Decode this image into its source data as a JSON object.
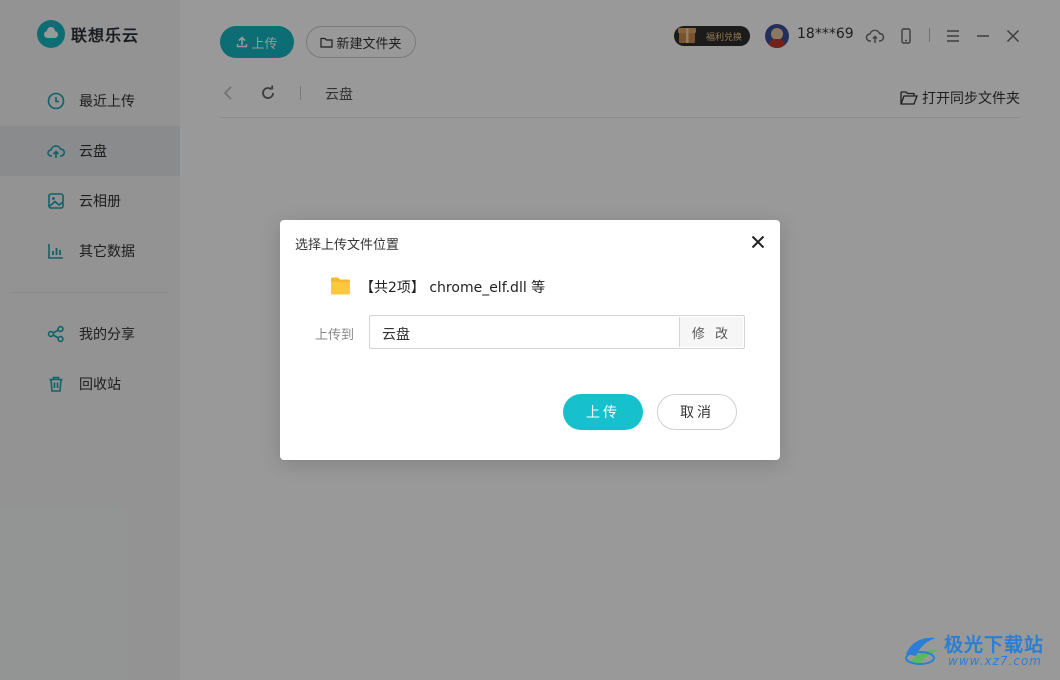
{
  "app": {
    "name": "联想乐云"
  },
  "sidebar": {
    "items": [
      {
        "label": "最近上传",
        "icon": "clock-icon"
      },
      {
        "label": "云盘",
        "icon": "cloud-upload-icon",
        "active": true
      },
      {
        "label": "云相册",
        "icon": "image-icon"
      },
      {
        "label": "其它数据",
        "icon": "bar-chart-icon"
      },
      {
        "label": "我的分享",
        "icon": "share-icon"
      },
      {
        "label": "回收站",
        "icon": "trash-icon"
      }
    ]
  },
  "toolbar": {
    "upload_label": "上传",
    "new_folder_label": "新建文件夹"
  },
  "header": {
    "welfare_label": "福利兑换",
    "username": "18***69",
    "icons": [
      "cloud-sync-icon",
      "phone-icon",
      "menu-icon",
      "minimize-icon",
      "close-icon"
    ]
  },
  "nav": {
    "breadcrumb": "云盘",
    "open_sync_folder_label": "打开同步文件夹"
  },
  "dialog": {
    "title": "选择上传文件位置",
    "file_summary": "【共2项】 chrome_elf.dll 等",
    "upload_to_label": "上传到",
    "destination_value": "云盘",
    "modify_label": "修 改",
    "confirm_label": "上传",
    "cancel_label": "取消"
  },
  "watermark": {
    "title": "极光下载站",
    "url": "www.xz7.com"
  },
  "colors": {
    "accent": "#16b6c1",
    "sidebar_bg": "#f5f6f7",
    "overlay": "rgba(0,0,0,0.40)"
  }
}
